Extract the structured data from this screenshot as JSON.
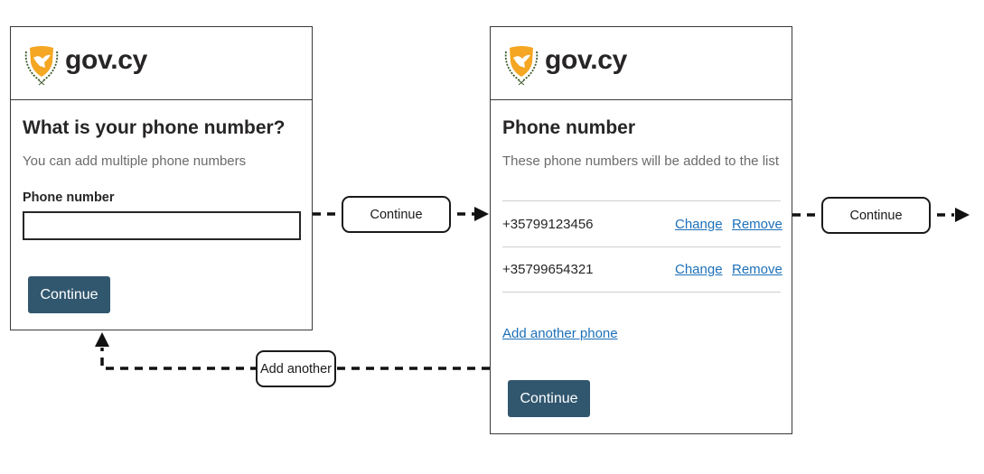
{
  "brand": {
    "name": "gov.cy",
    "crest_icon": "cyprus-coat-of-arms-icon",
    "crest_color": "#f5a623"
  },
  "screen1": {
    "title": "What is your phone number?",
    "hint": "You can add multiple phone numbers",
    "field_label": "Phone number",
    "field_value": "",
    "button_label": "Continue"
  },
  "screen2": {
    "title": "Phone number",
    "hint": "These phone numbers will be added to the list",
    "items": [
      {
        "phone": "+35799123456",
        "change_label": "Change",
        "remove_label": "Remove"
      },
      {
        "phone": "+35799654321",
        "change_label": "Change",
        "remove_label": "Remove"
      }
    ],
    "add_link": "Add another phone",
    "button_label": "Continue"
  },
  "flow": {
    "edge1_label": "Continue",
    "edge2_label": "Continue",
    "edge3_label": "Add another"
  },
  "colors": {
    "button": "#31576f",
    "link": "#1d70b8",
    "text": "#272525",
    "hint": "#6b6b6b"
  }
}
